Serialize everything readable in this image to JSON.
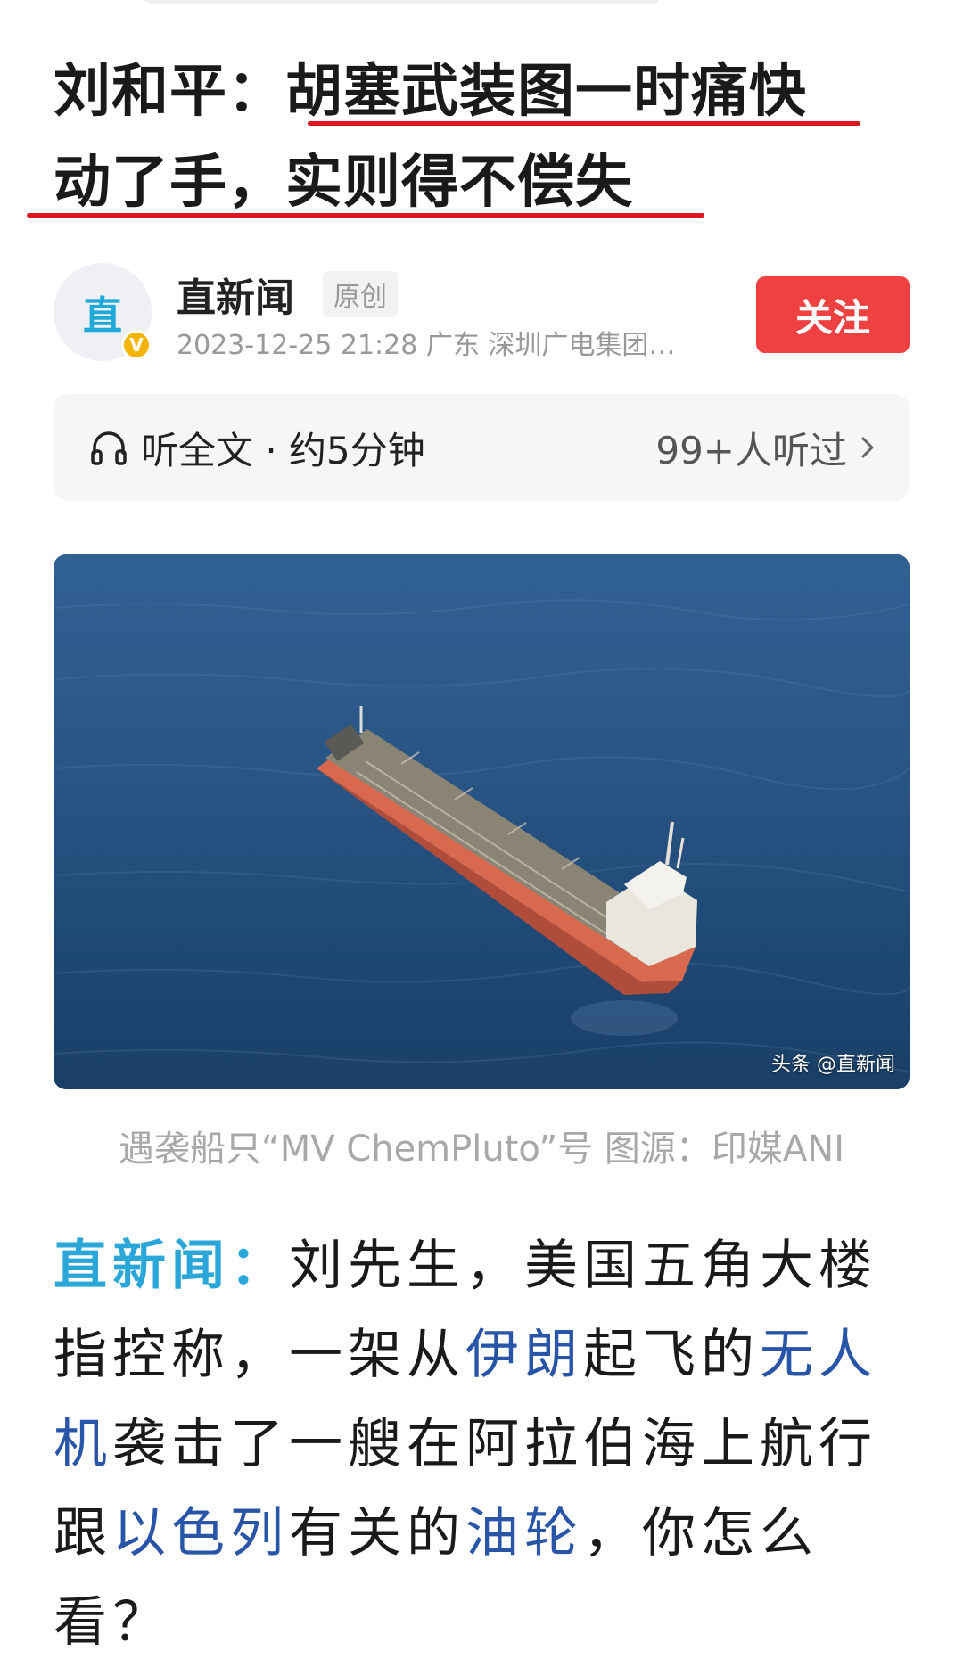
{
  "title": {
    "line1": "刘和平：胡塞武装图一时痛快",
    "line2": "动了手，实则得不偿失"
  },
  "author": {
    "avatar_glyph": "直",
    "verified_badge": "V",
    "name": "直新闻",
    "original_tag": "原创",
    "meta": "2023-12-25  21:28  广东  深圳广电集团…",
    "follow_label": "关注"
  },
  "listen": {
    "icon": "headphone-icon",
    "label": "听全文 · 约5分钟",
    "count": "99+人听过",
    "chevron": "chevron-right-icon"
  },
  "image": {
    "watermark": "头条 @直新闻",
    "caption": "遇袭船只“MV ChemPluto”号 图源：印媒ANI"
  },
  "body": {
    "lead": "直新闻：",
    "l1_rest": "刘先生，美国五角大楼",
    "l2_a": "指控称，一架从",
    "l2_kw1": "伊朗",
    "l2_b": "起飞的",
    "l2_kw2": "无人",
    "l3_kw": "机",
    "l3_rest": "袭击了一艘在阿拉伯海上航行",
    "l4_a": "跟",
    "l4_kw1": "以色列",
    "l4_b": "有关的",
    "l4_kw2": "油轮",
    "l4_c": "，你怎么",
    "l5": "看？"
  },
  "colors": {
    "underline": "#e0161e",
    "follow_button": "#f04142",
    "keyword": "#2855a8",
    "lead": "#2aa6d8"
  }
}
